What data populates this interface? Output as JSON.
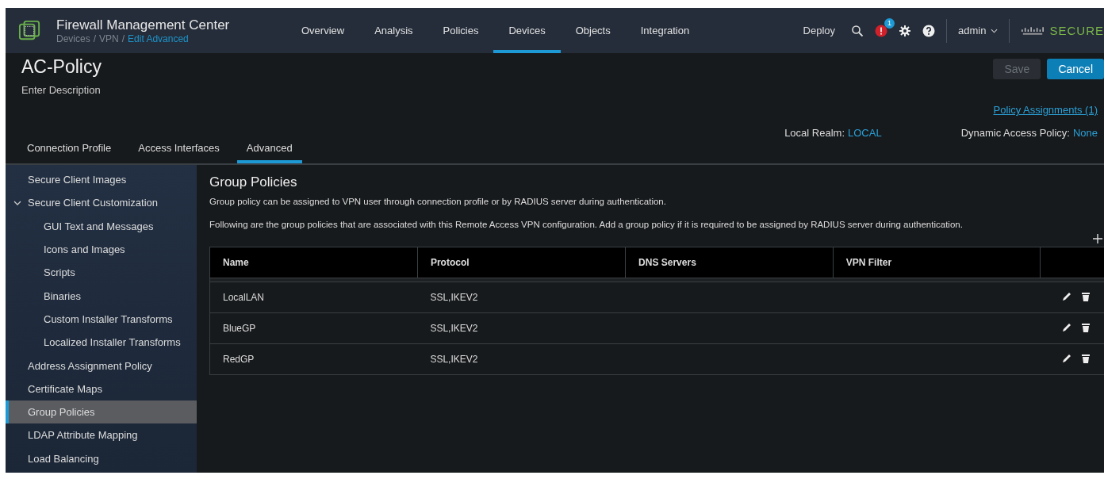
{
  "header": {
    "app_title": "Firewall Management Center",
    "breadcrumb": [
      "Devices",
      "VPN"
    ],
    "breadcrumb_separator": "/",
    "breadcrumb_current": "Edit Advanced",
    "nav": [
      {
        "label": "Overview",
        "selected": false
      },
      {
        "label": "Analysis",
        "selected": false
      },
      {
        "label": "Policies",
        "selected": false
      },
      {
        "label": "Devices",
        "selected": true
      },
      {
        "label": "Objects",
        "selected": false
      },
      {
        "label": "Integration",
        "selected": false
      }
    ],
    "deploy": "Deploy",
    "notification_count": "1",
    "user": "admin",
    "brand": "SECURE"
  },
  "policy": {
    "title": "AC-Policy",
    "description": "Enter Description",
    "save": "Save",
    "save_disabled": true,
    "cancel": "Cancel",
    "assignments_link": "Policy Assignments (1)",
    "local_realm_label": "Local Realm:",
    "local_realm": "LOCAL",
    "dap_label": "Dynamic Access Policy:",
    "dap": "None"
  },
  "tabs": [
    {
      "label": "Connection Profile",
      "selected": false
    },
    {
      "label": "Access Interfaces",
      "selected": false
    },
    {
      "label": "Advanced",
      "selected": true
    }
  ],
  "sidebar": {
    "items": [
      {
        "label": "Secure Client Images",
        "selected": false
      },
      {
        "label": "Secure Client Customization",
        "selected": false,
        "expanded": true,
        "children": [
          {
            "label": "GUI Text and Messages",
            "selected": false
          },
          {
            "label": "Icons and Images",
            "selected": false
          },
          {
            "label": "Scripts",
            "selected": false
          },
          {
            "label": "Binaries",
            "selected": false
          },
          {
            "label": "Custom Installer Transforms",
            "selected": false
          },
          {
            "label": "Localized Installer Transforms",
            "selected": false
          }
        ]
      },
      {
        "label": "Address Assignment Policy",
        "selected": false
      },
      {
        "label": "Certificate Maps",
        "selected": false
      },
      {
        "label": "Group Policies",
        "selected": true
      },
      {
        "label": "LDAP Attribute Mapping",
        "selected": false
      },
      {
        "label": "Load Balancing",
        "selected": false
      }
    ]
  },
  "content": {
    "title": "Group Policies",
    "intro": "Group policy can be assigned to VPN user through connection profile or by RADIUS server during authentication.",
    "detail": "Following are the group policies that are associated with this Remote Access VPN configuration. Add a group policy if it is required to be assigned by RADIUS server during authentication.",
    "table": {
      "columns": [
        "Name",
        "Protocol",
        "DNS Servers",
        "VPN Filter"
      ],
      "rows": [
        {
          "name": "LocalLAN",
          "protocol": "SSL,IKEV2"
        },
        {
          "name": "BlueGP",
          "protocol": "SSL,IKEV2"
        },
        {
          "name": "RedGP",
          "protocol": "SSL,IKEV2"
        }
      ]
    }
  }
}
